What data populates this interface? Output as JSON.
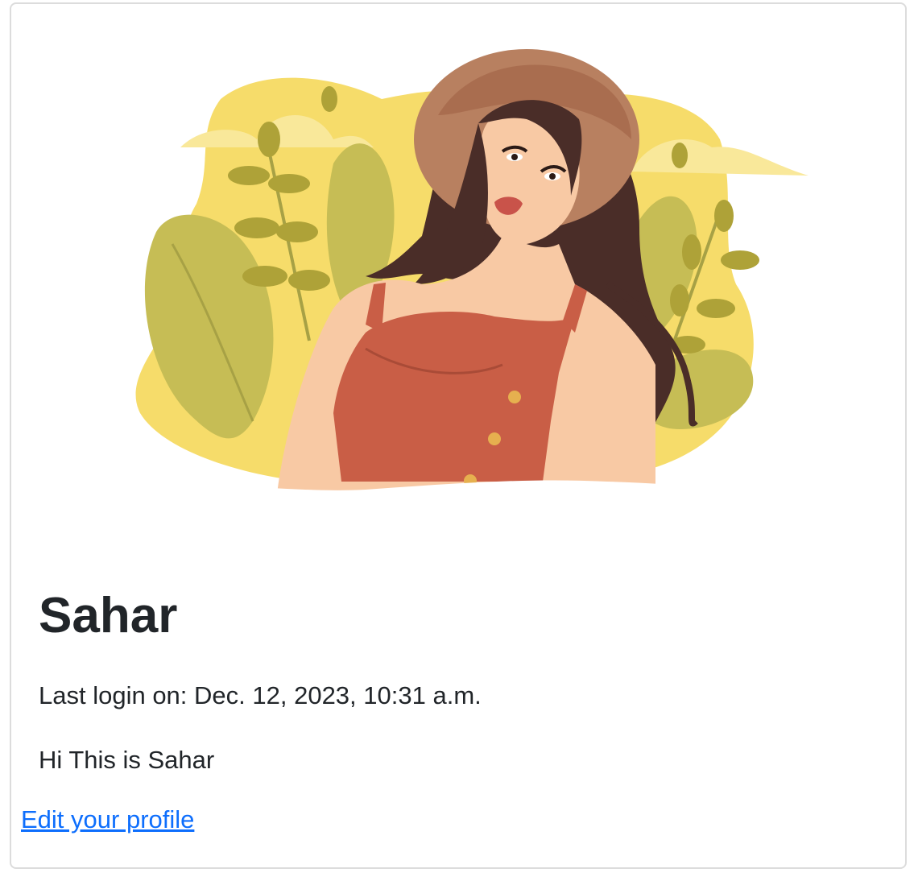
{
  "profile": {
    "avatar_name": "woman-illustration",
    "username": "Sahar",
    "last_login": "Last login on: Dec. 12, 2023, 10:31 a.m.",
    "bio": "Hi This is Sahar",
    "edit_link_label": "Edit your profile"
  },
  "colors": {
    "text": "#212529",
    "link": "#0d6efd",
    "card_border": "#dcdcdc",
    "illustration_yellow": "#f6dc6a",
    "illustration_leaf": "#c6bd55",
    "illustration_dress": "#c95e46",
    "illustration_hair": "#4a2d28",
    "illustration_hat": "#b88060"
  }
}
